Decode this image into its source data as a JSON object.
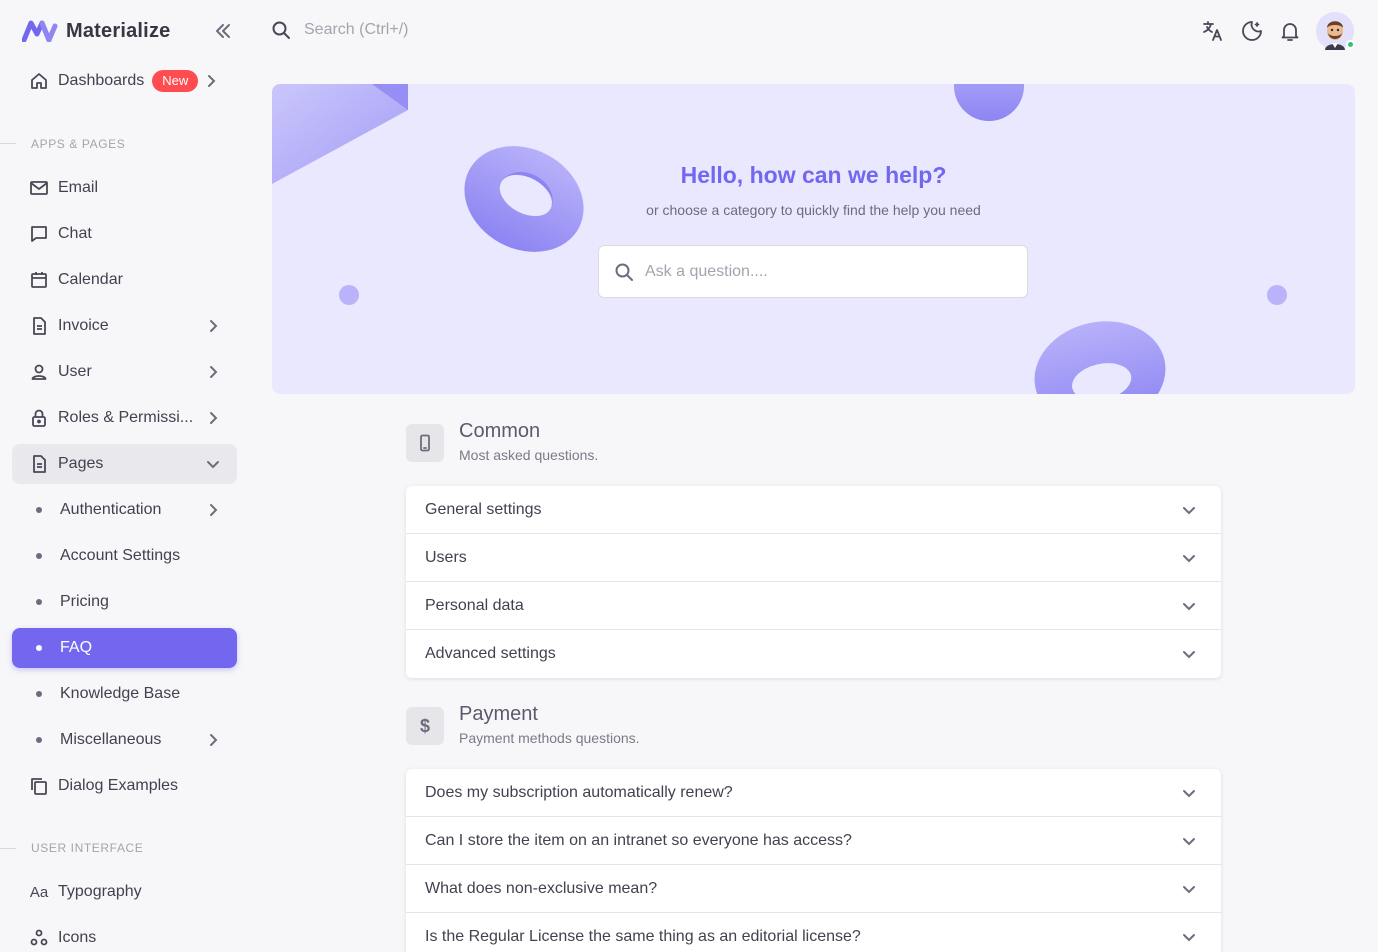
{
  "brand": {
    "name": "Materialize",
    "color": "#7367f0"
  },
  "topbar": {
    "search_placeholder": "Search (Ctrl+/)",
    "icons": [
      "translate-icon",
      "moon-icon",
      "bell-icon"
    ],
    "status_color": "#28c76f"
  },
  "sidebar": {
    "dashboards": {
      "label": "Dashboards",
      "badge": "New"
    },
    "section_apps": "APPS & PAGES",
    "email": "Email",
    "chat": "Chat",
    "calendar": "Calendar",
    "invoice": "Invoice",
    "user": "User",
    "roles": "Roles & Permissi...",
    "pages": "Pages",
    "authentication": "Authentication",
    "account_settings": "Account Settings",
    "pricing": "Pricing",
    "faq": "FAQ",
    "knowledge_base": "Knowledge Base",
    "miscellaneous": "Miscellaneous",
    "dialog_examples": "Dialog Examples",
    "section_ui": "USER INTERFACE",
    "typography": "Typography",
    "typography_glyph": "Aa",
    "icons": "Icons"
  },
  "hero": {
    "title": "Hello, how can we help?",
    "subtitle": "or choose a category to quickly find the help you need",
    "search_placeholder": "Ask a question...."
  },
  "faq": {
    "common": {
      "title": "Common",
      "desc": "Most asked questions.",
      "questions": [
        "General settings",
        "Users",
        "Personal data",
        "Advanced settings"
      ]
    },
    "payment": {
      "title": "Payment",
      "desc": "Payment methods questions.",
      "icon_glyph": "$",
      "questions": [
        "Does my subscription automatically renew?",
        "Can I store the item on an intranet so everyone has access?",
        "What does non-exclusive mean?",
        "Is the Regular License the same thing as an editorial license?"
      ]
    }
  }
}
